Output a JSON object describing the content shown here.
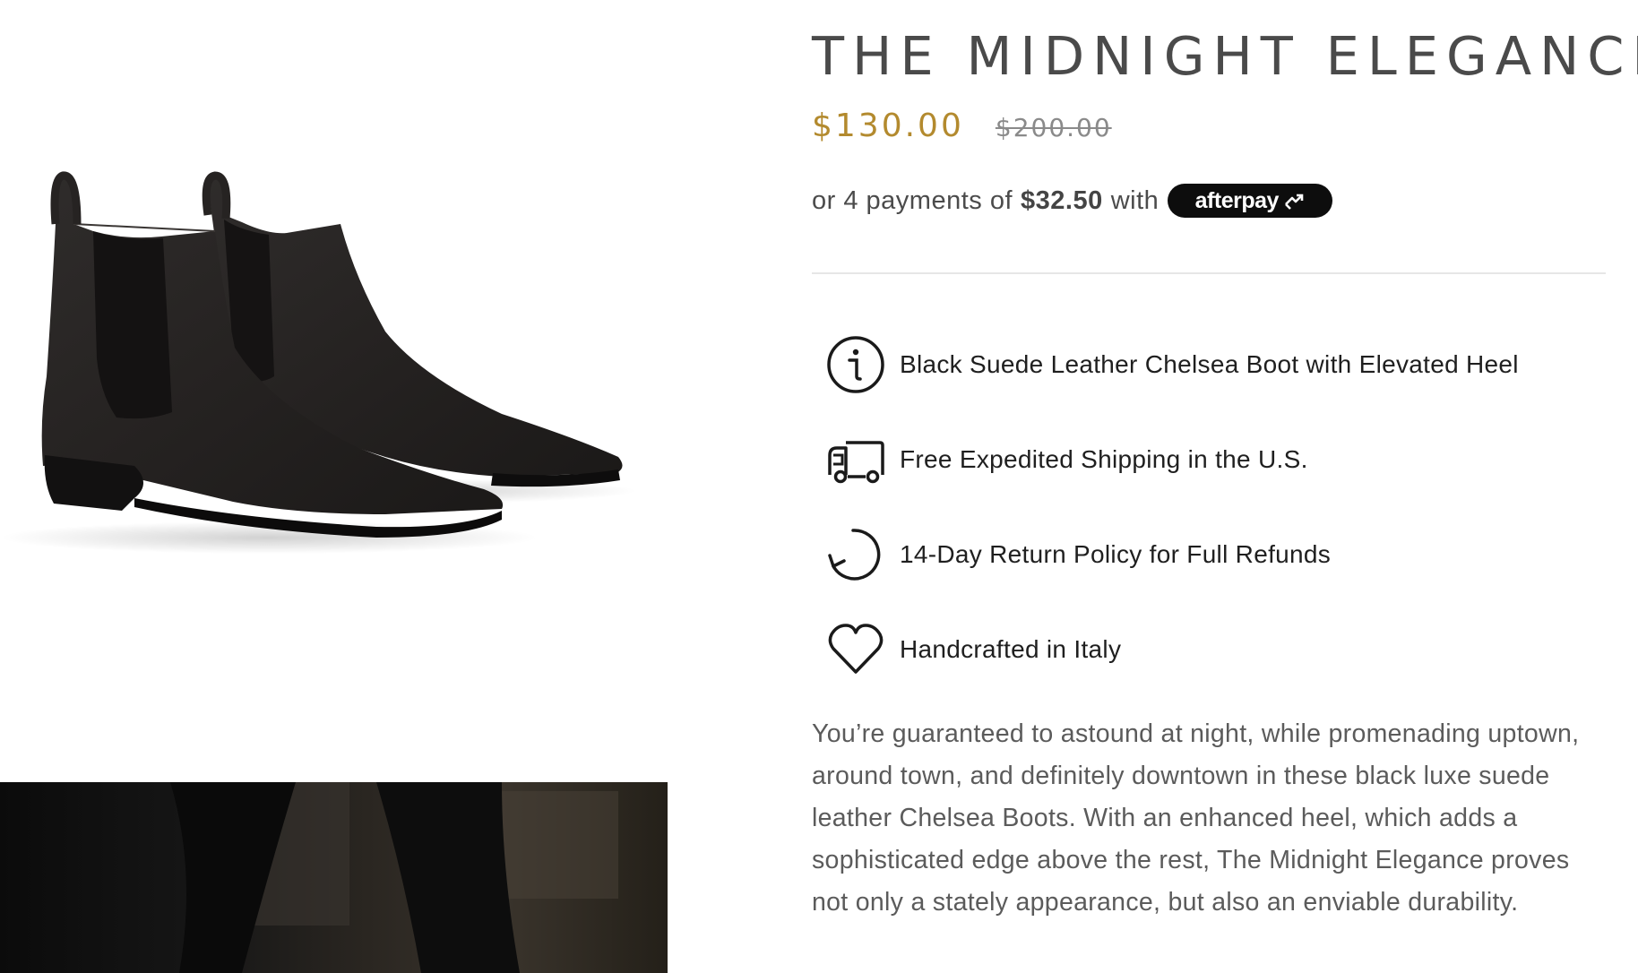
{
  "product": {
    "title": "THE MIDNIGHT ELEGANCE",
    "price_current": "$130.00",
    "price_original": "$200.00",
    "installments": {
      "prefix": "or 4 payments of",
      "amount": "$32.50",
      "suffix": "with",
      "provider": "afterpay",
      "provider_icon": "afterpay-arrows-icon"
    },
    "features": [
      {
        "icon": "info-icon",
        "label": "Black Suede Leather Chelsea Boot with Elevated Heel"
      },
      {
        "icon": "truck-icon",
        "label": "Free Expedited Shipping in the U.S."
      },
      {
        "icon": "return-arrow-icon",
        "label": "14-Day Return Policy for Full Refunds"
      },
      {
        "icon": "heart-icon",
        "label": "Handcrafted in Italy"
      }
    ],
    "description": "You’re guaranteed to astound at night, while promenading uptown, around town, and definitely downtown in these black luxe suede leather Chelsea Boots. With an enhanced heel, which adds a sophisticated edge above the rest, The Midnight Elegance proves not only a stately appearance, but also an enviable durability."
  },
  "colors": {
    "price_accent": "#b38a2e",
    "title_text": "#4a4a4a",
    "badge_background": "#0d0d0d"
  }
}
